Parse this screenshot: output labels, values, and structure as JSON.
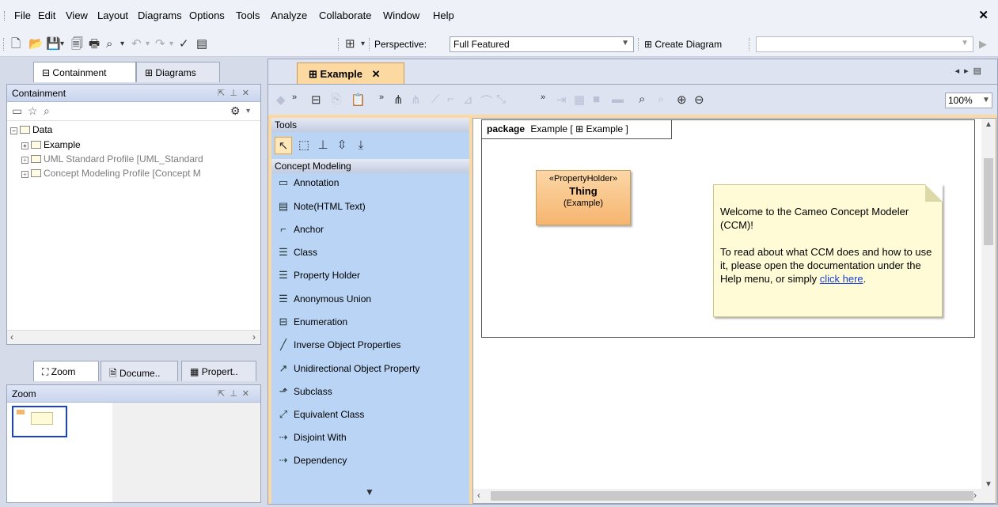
{
  "menu": [
    "File",
    "Edit",
    "View",
    "Layout",
    "Diagrams",
    "Options",
    "Tools",
    "Analyze",
    "Collaborate",
    "Window",
    "Help"
  ],
  "toolbar": {
    "perspective_label": "Perspective:",
    "perspective_value": "Full Featured",
    "create_diagram_label": "Create Diagram"
  },
  "left_tabs": {
    "containment": "Containment",
    "diagrams": "Diagrams"
  },
  "containment_panel": {
    "title": "Containment",
    "tree": [
      {
        "label": "Data"
      },
      {
        "label": "Example"
      },
      {
        "label": "UML Standard Profile [UML_Standard"
      },
      {
        "label": "Concept Modeling Profile [Concept M"
      }
    ]
  },
  "bottom_tabs": {
    "zoom": "Zoom",
    "docume": "Docume..",
    "propert": "Propert.."
  },
  "zoom_panel": {
    "title": "Zoom"
  },
  "editor": {
    "tab_label": "Example",
    "zoom_value": "100%"
  },
  "palette": {
    "tools_header": "Tools",
    "section": "Concept Modeling",
    "items": [
      {
        "label": "Annotation",
        "icon": "annotation-icon"
      },
      {
        "label": "Note(HTML Text)",
        "icon": "html-note-icon"
      },
      {
        "label": "Anchor",
        "icon": "anchor-icon"
      },
      {
        "label": "Class",
        "icon": "class-icon"
      },
      {
        "label": "Property Holder",
        "icon": "class-icon"
      },
      {
        "label": "Anonymous Union",
        "icon": "class-icon"
      },
      {
        "label": "Enumeration",
        "icon": "enumeration-icon"
      },
      {
        "label": "Inverse Object Properties",
        "icon": "line-icon"
      },
      {
        "label": "Unidirectional Object Property",
        "icon": "arrow-line-icon"
      },
      {
        "label": "Subclass",
        "icon": "generalization-icon"
      },
      {
        "label": "Equivalent Class",
        "icon": "equivalent-icon"
      },
      {
        "label": "Disjoint With",
        "icon": "dashed-arrow-icon"
      },
      {
        "label": "Dependency",
        "icon": "dashed-arrow-icon"
      }
    ]
  },
  "diagram": {
    "frame_keyword": "package",
    "frame_name": "Example [",
    "frame_ref": "Example ]",
    "thing": {
      "stereotype": "«PropertyHolder»",
      "name": "Thing",
      "owner": "(Example)"
    },
    "note": {
      "line1": "Welcome to the Cameo Concept Modeler (CCM)!",
      "line2": "To read about what CCM does and how to use it, please open the documentation under the Help menu, or simply",
      "link": "click here",
      "tail": "."
    }
  },
  "colors": {
    "accent_tab": "#fbd9a0",
    "palette_bg": "#b9d4f4",
    "note_bg": "#fefbd6",
    "link": "#1a3fd6"
  }
}
